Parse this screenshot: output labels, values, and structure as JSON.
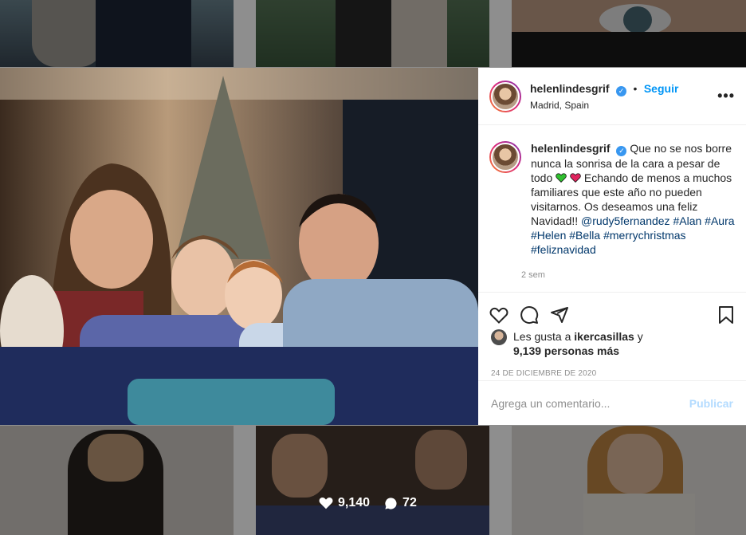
{
  "post": {
    "username": "helenlindesgrif",
    "verified_mark": "✓",
    "dot": "•",
    "follow_label": "Seguir",
    "location": "Madrid, Spain",
    "more_label": "•••",
    "caption_user": "helenlindesgrif",
    "caption_line1": "Que no se nos borre nunca la sonrisa de la cara a pesar de todo",
    "caption_line2": "Echando de menos a muchos familiares que este año no pueden visitarnos. Os deseamos una feliz Navidad!!",
    "tags": [
      "@rudy5fernandez",
      "#Alan",
      "#Aura",
      "#Helen",
      "#Bella",
      "#merrychristmas",
      "#feliznavidad"
    ],
    "time_ago": "2 sem",
    "likes_prefix": "Les gusta a",
    "likes_user": "ikercasillas",
    "likes_and": "y",
    "likes_count": "9,139 personas más",
    "date": "24 DE DICIEMBRE DE 2020",
    "comment_placeholder": "Agrega un comentario...",
    "publish_label": "Publicar"
  },
  "background_grid": {
    "hover_likes": "9,140",
    "hover_comments": "72"
  },
  "colors": {
    "accent": "#0095f6",
    "publish_disabled": "#b3dbff",
    "heart_green": "#2fbf2f",
    "heart_red": "#e0245e"
  }
}
